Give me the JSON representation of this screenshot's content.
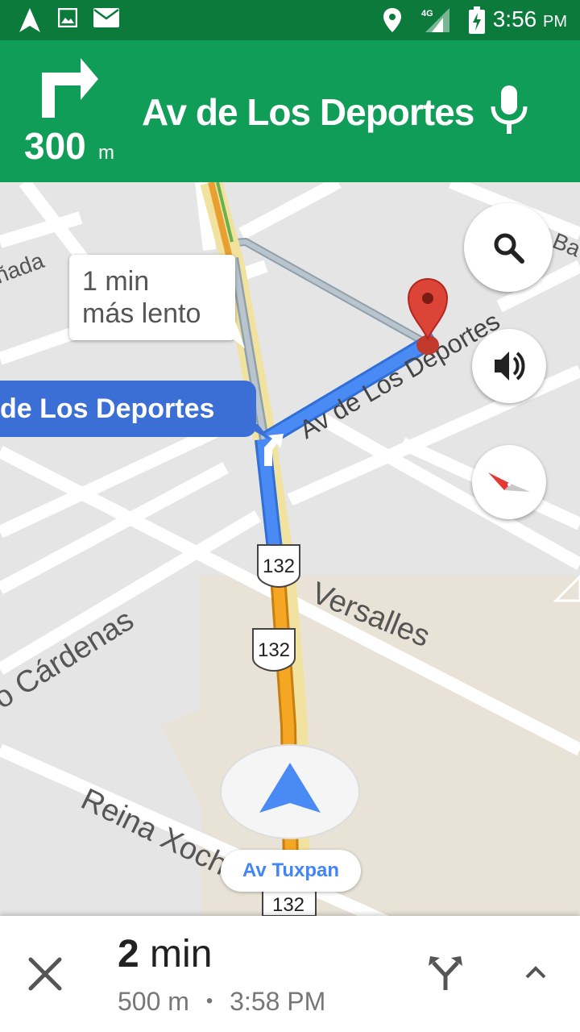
{
  "status_bar": {
    "time": "3:56",
    "ampm": "PM",
    "network": "4G",
    "icons": [
      "navigation-icon",
      "image-icon",
      "mail-icon",
      "location-pin-icon",
      "signal-icon",
      "battery-charging-icon"
    ]
  },
  "nav_header": {
    "distance_value": "300",
    "distance_unit": "m",
    "street": "Av de Los Deportes",
    "turn_icon": "turn-right-icon",
    "mic_icon": "microphone-icon"
  },
  "map": {
    "callout_line1": "1 min",
    "callout_line2": "más lento",
    "current_street_chip": "de Los Deportes",
    "route_street_label": "Av de Los Deportes",
    "labels": {
      "canada": "ñada",
      "versalles": "Versalles",
      "cardenas": "o Cárdenas",
      "reina": "Reina Xochitl",
      "ba": "Ba"
    },
    "shields": [
      "132",
      "132",
      "132"
    ],
    "current_location_chip": "Av Tuxpan"
  },
  "floating_buttons": {
    "search": "search-icon",
    "sound": "volume-icon",
    "compass": "compass-icon"
  },
  "bottom_bar": {
    "eta_value": "2",
    "eta_unit": "min",
    "distance": "500 m",
    "separator": "•",
    "arrival_time": "3:58 PM"
  },
  "colors": {
    "header_green": "#0f9d58",
    "statusbar_green": "#0b7a3b",
    "route_blue": "#4a8af4",
    "traffic_orange": "#f5a623",
    "chip_blue": "#3b6fd6",
    "pin_red": "#db4437"
  }
}
